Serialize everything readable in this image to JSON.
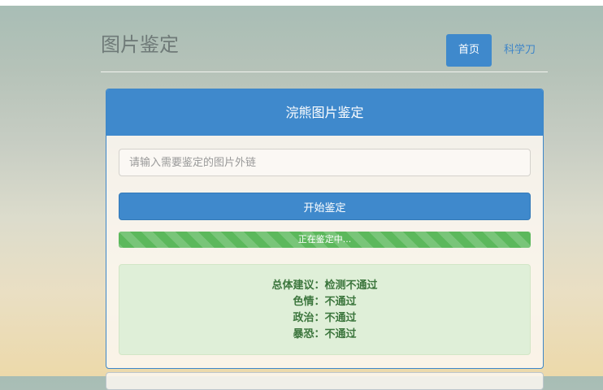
{
  "site": {
    "title": "图片鉴定"
  },
  "nav": {
    "items": [
      {
        "label": "首页",
        "active": true
      },
      {
        "label": "科学刀",
        "active": false
      }
    ]
  },
  "panel": {
    "title": "浣熊图片鉴定",
    "input": {
      "value": "",
      "placeholder": "请输入需要鉴定的图片外链"
    },
    "start_button_label": "开始鉴定",
    "progress": {
      "label": "正在鉴定中...",
      "percent": 100
    },
    "result": {
      "lines": [
        "总体建议：检测不通过",
        "色情：不通过",
        "政治：不通过",
        "暴恐：不通过"
      ]
    }
  },
  "colors": {
    "primary": "#3f89cc",
    "success": "#5cb85c",
    "result_text": "#3c763d",
    "result_bg": "#dfefd8"
  }
}
